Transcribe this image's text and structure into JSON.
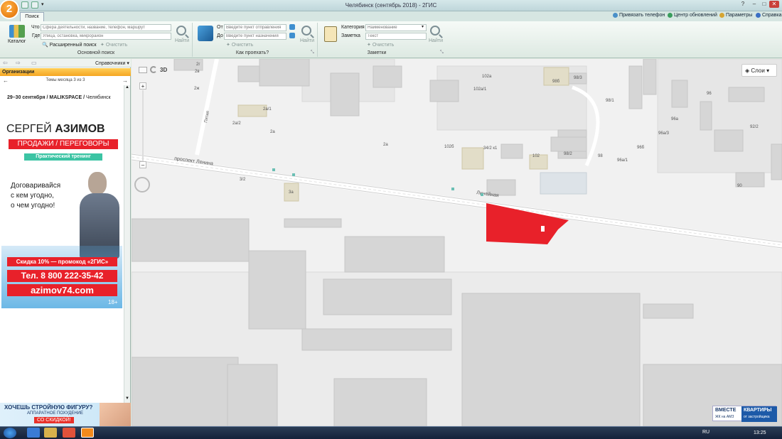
{
  "window": {
    "title": "Челябинск (сентябрь 2018) - 2ГИС",
    "logo_text": "2"
  },
  "tabs": [
    {
      "label": "Поиск"
    }
  ],
  "top_links": {
    "phone": "Привязать телефон",
    "updates": "Центр обновлений",
    "params": "Параметры",
    "help": "Справка"
  },
  "ribbon": {
    "catalog_label": "Каталог",
    "main_search": {
      "what_label": "Что",
      "what_placeholder": "Сфера деятельности, название, телефон, маршрут",
      "where_label": "Где",
      "where_placeholder": "Улица, остановка, микрорайон",
      "find_label": "Найти",
      "advanced_label": "Расширенный поиск",
      "clear_label": "Очистить",
      "group_label": "Основной поиск"
    },
    "route": {
      "from_label": "От",
      "from_placeholder": "Введите пункт отправления",
      "to_label": "До",
      "to_placeholder": "Введите пункт назначения",
      "find_label": "Найти",
      "clear_label": "Очистить",
      "group_label": "Как проехать?"
    },
    "notes": {
      "category_label": "Категория",
      "category_placeholder": "Наименование",
      "note_label": "Заметка",
      "note_placeholder": "Текст",
      "find_label": "Найти",
      "clear_label": "Очистить",
      "group_label": "Заметки"
    }
  },
  "left_panel": {
    "directories_label": "Справочники",
    "org_header": "Организации",
    "themes_label": "Темы месяца 3 из 3",
    "ad": {
      "date": "29–30 сентября",
      "brand": "MALIKSPACE",
      "city": "Челябинск",
      "name_first": "СЕРГЕЙ",
      "name_last": "АЗИМОВ",
      "sales": "ПРОДАЖИ / ПЕРЕГОВОРЫ",
      "training": "Практический тренинг",
      "slogan_1": "Договаривайся",
      "slogan_2": "с кем угодно,",
      "slogan_3": "о чем угодно!",
      "discount": "Скидка 10% — промокод «2ГИС»",
      "phone": "Тел. 8 800 222-35-42",
      "site": "azimov74.com",
      "age": "18+"
    },
    "ad2": {
      "line1": "ХОЧЕШЬ СТРОЙНУЮ ФИГУРУ?",
      "line2": "АППАРАТНОЕ ПОХУДЕНИЕ",
      "line3": "СО СКИДКОЙ!"
    }
  },
  "map": {
    "mode_3d": "3D",
    "layers_label": "Слои",
    "street_labels": [
      "проспект Ленина",
      "Линейная",
      "Пятая"
    ],
    "building_labels": [
      "2г",
      "2в",
      "2ж",
      "2а/1",
      "2а/2",
      "2а",
      "2а",
      "3/2",
      "3а",
      "102а",
      "102а/1",
      "102б",
      "34/2 к1",
      "102",
      "98б",
      "98/3",
      "98/1",
      "98/2",
      "98",
      "96",
      "96а",
      "96а/3",
      "96б",
      "96а/1",
      "92/2",
      "90"
    ],
    "selected_color": "#e8212a",
    "banner": {
      "line1": "ВМЕСТЕ",
      "line2": "ЖК на АМЗ",
      "line3": "КВАРТИРЫ",
      "line4": "от застройщика"
    }
  },
  "taskbar": {
    "lang": "RU",
    "time": "13:25"
  }
}
